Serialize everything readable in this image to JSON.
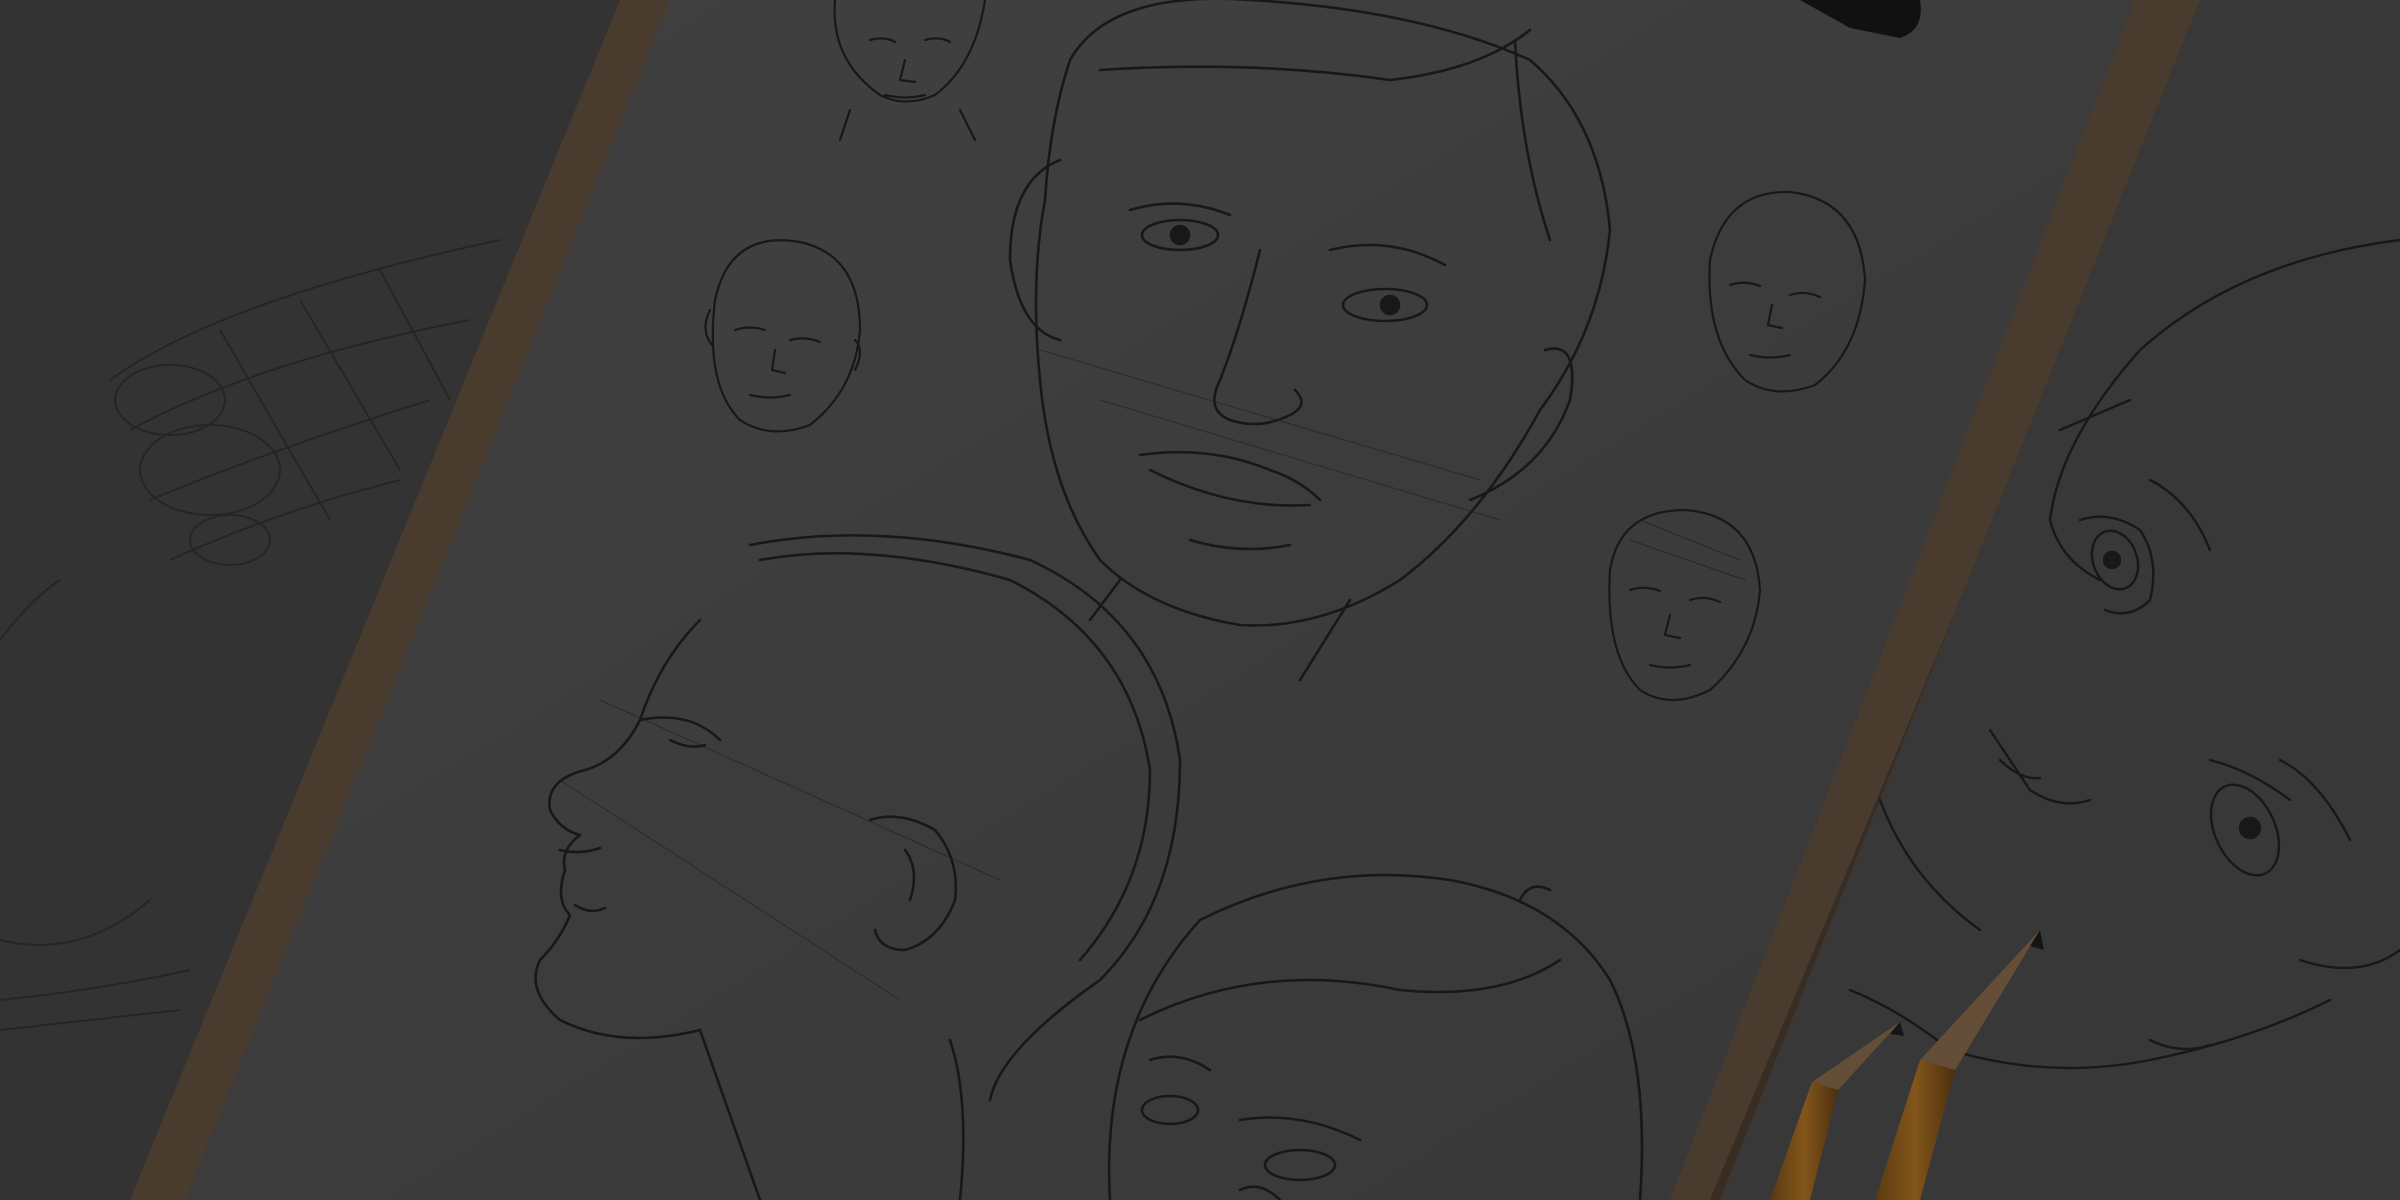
{
  "scene": {
    "description_visible_text": "",
    "colors": {
      "background": "#2b2b2b",
      "paper": "#4a4a4a",
      "paper_shadow": "#3a3a3a",
      "board": "#5c4b3b",
      "board_edge": "#463829",
      "sketch_line": "#1e1e1e",
      "pencil_wood": "#8a5a1c",
      "pencil_tip": "#2a2a2a",
      "overlay": "rgba(0,0,0,0.18)"
    },
    "icons": [
      "pencil-icon",
      "sketch-face-icon"
    ]
  }
}
